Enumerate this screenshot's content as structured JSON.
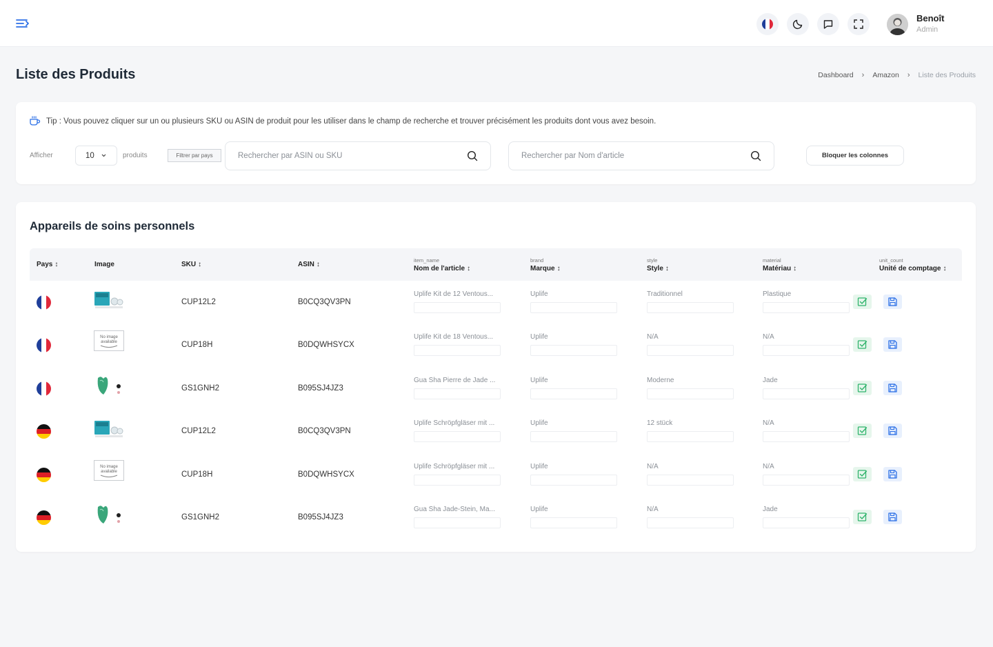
{
  "header": {
    "user_name": "Benoît",
    "user_role": "Admin",
    "icons": [
      "menu-icon",
      "flag-fr-icon",
      "moon-icon",
      "chat-icon",
      "fullscreen-icon"
    ]
  },
  "page": {
    "title": "Liste des Produits",
    "breadcrumb": [
      "Dashboard",
      "Amazon",
      "Liste des Produits"
    ]
  },
  "filters": {
    "tip": "Tip : Vous pouvez cliquer sur un ou plusieurs SKU ou ASIN de produit pour les utiliser dans le champ de recherche et trouver précisément les produits dont vous avez besoin.",
    "show_label": "Afficher",
    "page_size": "10",
    "products_label": "produits",
    "filter_country": "Filtrer par pays",
    "search_asin_placeholder": "Rechercher par ASIN ou SKU",
    "search_name_placeholder": "Rechercher par Nom d'article",
    "lock_columns": "Bloquer les colonnes"
  },
  "table": {
    "title": "Appareils de soins personnels",
    "columns": [
      {
        "sub": "",
        "label": "Pays",
        "sortable": true
      },
      {
        "sub": "",
        "label": "Image",
        "sortable": false
      },
      {
        "sub": "",
        "label": "SKU",
        "sortable": true
      },
      {
        "sub": "",
        "label": "ASIN",
        "sortable": true
      },
      {
        "sub": "item_name",
        "label": "Nom de l'article",
        "sortable": true
      },
      {
        "sub": "brand",
        "label": "Marque",
        "sortable": true
      },
      {
        "sub": "style",
        "label": "Style",
        "sortable": true
      },
      {
        "sub": "material",
        "label": "Matériau",
        "sortable": true
      },
      {
        "sub": "unit_count",
        "label": "Unité de comptage",
        "sortable": true
      }
    ],
    "sort_glyph": "↕",
    "rows": [
      {
        "country": "fr",
        "image": "cupping-kit",
        "sku": "CUP12L2",
        "asin": "B0CQ3QV3PN",
        "name": "Uplife Kit de 12 Ventous...",
        "brand": "Uplife",
        "style": "Traditionnel",
        "material": "Plastique"
      },
      {
        "country": "fr",
        "image": "no-image",
        "sku": "CUP18H",
        "asin": "B0DQWHSYCX",
        "name": "Uplife Kit de 18 Ventous...",
        "brand": "Uplife",
        "style": "N/A",
        "material": "N/A"
      },
      {
        "country": "fr",
        "image": "gua-sha",
        "sku": "GS1GNH2",
        "asin": "B095SJ4JZ3",
        "name": "Gua Sha Pierre de Jade ...",
        "brand": "Uplife",
        "style": "Moderne",
        "material": "Jade"
      },
      {
        "country": "de",
        "image": "cupping-kit",
        "sku": "CUP12L2",
        "asin": "B0CQ3QV3PN",
        "name": "Uplife Schröpfgläser mit ...",
        "brand": "Uplife",
        "style": "12 stück",
        "material": "N/A"
      },
      {
        "country": "de",
        "image": "no-image",
        "sku": "CUP18H",
        "asin": "B0DQWHSYCX",
        "name": "Uplife Schröpfgläser mit ...",
        "brand": "Uplife",
        "style": "N/A",
        "material": "N/A"
      },
      {
        "country": "de",
        "image": "gua-sha",
        "sku": "GS1GNH2",
        "asin": "B095SJ4JZ3",
        "name": "Gua Sha Jade-Stein, Ma...",
        "brand": "Uplife",
        "style": "N/A",
        "material": "Jade"
      }
    ],
    "no_image_text": "No image available"
  },
  "colors": {
    "accent": "#2b6fe6",
    "success": "#2fb36b",
    "fr_blue": "#1f3f9a",
    "fr_red": "#e0283a",
    "de_black": "#111111",
    "de_red": "#dd1f26",
    "de_gold": "#ffcc00"
  }
}
